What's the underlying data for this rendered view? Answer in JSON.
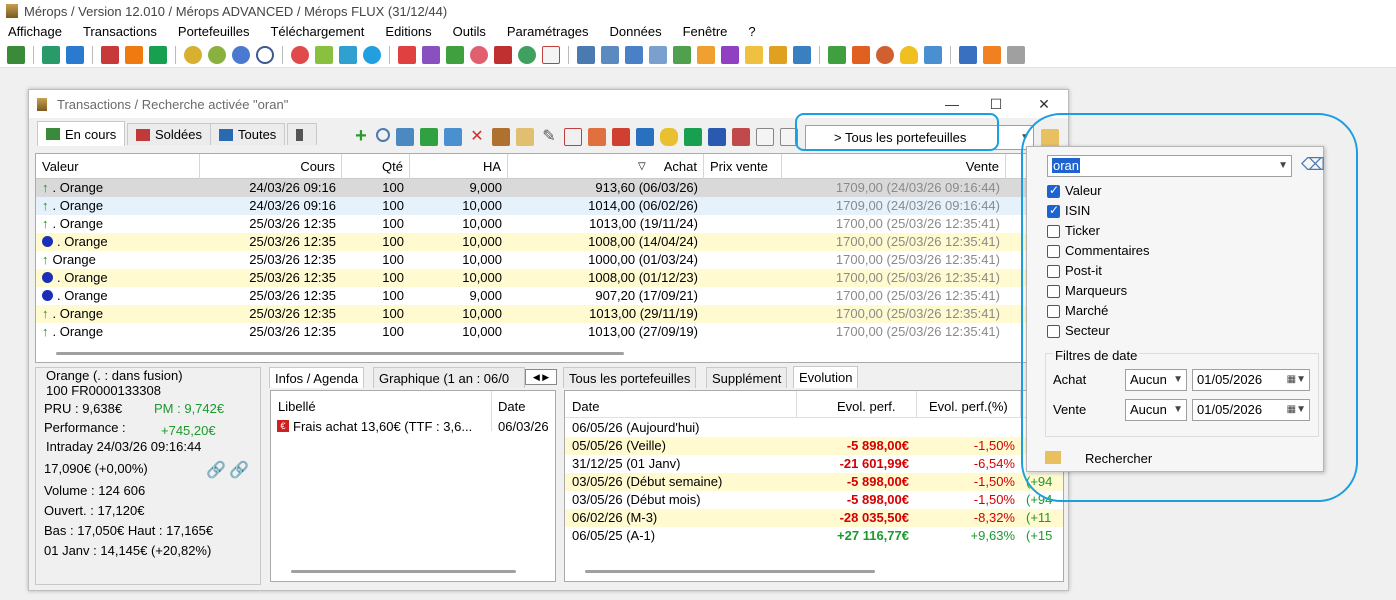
{
  "app": {
    "title": "Mérops / Version 12.010 / Mérops ADVANCED / Mérops FLUX (31/12/44)"
  },
  "menu": [
    "Affichage",
    "Transactions",
    "Portefeuilles",
    "Téléchargement",
    "Editions",
    "Outils",
    "Paramétrages",
    "Données",
    "Fenêtre",
    "?"
  ],
  "window": {
    "title": "Transactions / Recherche activée \"oran\"",
    "tabs": [
      "En cours",
      "Soldées",
      "Toutes"
    ],
    "portfolio_selector": "> Tous les portefeuilles"
  },
  "grid": {
    "columns": [
      "Valeur",
      "Cours",
      "Qté",
      "HA",
      "Achat",
      "Prix vente",
      "Vente"
    ],
    "rows": [
      {
        "mark": "arrow",
        "valeur": ". Orange",
        "cours": "24/03/26 09:16",
        "qte": "100",
        "ha": "9,000",
        "achat": "913,60 (06/03/26)",
        "vente": "1709,00 (24/03/26 09:16:44)"
      },
      {
        "mark": "arrow",
        "valeur": ". Orange",
        "cours": "24/03/26 09:16",
        "qte": "100",
        "ha": "10,000",
        "achat": "1014,00 (06/02/26)",
        "vente": "1709,00 (24/03/26 09:16:44)"
      },
      {
        "mark": "arrow",
        "valeur": ". Orange",
        "cours": "25/03/26 12:35",
        "qte": "100",
        "ha": "10,000",
        "achat": "1013,00 (19/11/24)",
        "vente": "1700,00 (25/03/26 12:35:41)"
      },
      {
        "mark": "dot",
        "valeur": ". Orange",
        "cours": "25/03/26 12:35",
        "qte": "100",
        "ha": "10,000",
        "achat": "1008,00 (14/04/24)",
        "vente": "1700,00 (25/03/26 12:35:41)"
      },
      {
        "mark": "arrow",
        "valeur": "Orange",
        "cours": "25/03/26 12:35",
        "qte": "100",
        "ha": "10,000",
        "achat": "1000,00 (01/03/24)",
        "vente": "1700,00 (25/03/26 12:35:41)"
      },
      {
        "mark": "dot",
        "valeur": ". Orange",
        "cours": "25/03/26 12:35",
        "qte": "100",
        "ha": "10,000",
        "achat": "1008,00 (01/12/23)",
        "vente": "1700,00 (25/03/26 12:35:41)"
      },
      {
        "mark": "dot",
        "valeur": ". Orange",
        "cours": "25/03/26 12:35",
        "qte": "100",
        "ha": "9,000",
        "achat": "907,20 (17/09/21)",
        "vente": "1700,00 (25/03/26 12:35:41)"
      },
      {
        "mark": "arrow",
        "valeur": ". Orange",
        "cours": "25/03/26 12:35",
        "qte": "100",
        "ha": "10,000",
        "achat": "1013,00 (29/11/19)",
        "vente": "1700,00 (25/03/26 12:35:41)"
      },
      {
        "mark": "arrow",
        "valeur": ". Orange",
        "cours": "25/03/26 12:35",
        "qte": "100",
        "ha": "10,000",
        "achat": "1013,00 (27/09/19)",
        "vente": "1700,00 (25/03/26 12:35:41)"
      }
    ]
  },
  "info": {
    "name": "Orange (. : dans fusion)",
    "isin": "100 FR0000133308",
    "pru": "PRU : 9,638€",
    "pm": "PM : 9,742€",
    "performance_label": "Performance :",
    "performance_value": "+745,20€",
    "intraday": "Intraday 24/03/26 09:16:44",
    "price": "17,090€ (+0,00%)",
    "volume": "Volume : 124 606",
    "ouvert": "Ouvert. : 17,120€",
    "bas_haut": "Bas : 17,050€ Haut : 17,165€",
    "janv": "01 Janv : 14,145€ (+20,82%)"
  },
  "mid_tabs": [
    "Infos / Agenda",
    "Graphique (1 an : 06/0"
  ],
  "agenda": {
    "columns": [
      "Libellé",
      "Date"
    ],
    "rows": [
      {
        "libelle": "Frais achat 13,60€ (TTF : 3,6...",
        "date": "06/03/26"
      }
    ]
  },
  "right_tabs": [
    "Tous les portefeuilles",
    "Supplément",
    "Evolution"
  ],
  "evolution": {
    "columns": [
      "Date",
      "Evol. perf.",
      "Evol. perf.(%)"
    ],
    "rows": [
      {
        "date": "06/05/26 (Aujourd'hui)",
        "perf": "",
        "pct": "",
        "extra": "(+"
      },
      {
        "date": "05/05/26 (Veille)",
        "perf": "-5 898,00€",
        "pct": "-1,50%",
        "extra": "(+"
      },
      {
        "date": "31/12/25 (01 Janv)",
        "perf": "-21 601,99€",
        "pct": "-6,54%",
        "extra": "(+"
      },
      {
        "date": "03/05/26 (Début semaine)",
        "perf": "-5 898,00€",
        "pct": "-1,50%",
        "extra": "(+94"
      },
      {
        "date": "03/05/26 (Début mois)",
        "perf": "-5 898,00€",
        "pct": "-1,50%",
        "extra": "(+94"
      },
      {
        "date": "06/02/26 (M-3)",
        "perf": "-28 035,50€",
        "pct": "-8,32%",
        "extra": "(+11"
      },
      {
        "date": "06/05/25 (A-1)",
        "perf": "+27 116,77€",
        "pct": "+9,63%",
        "extra": "(+15"
      }
    ]
  },
  "search": {
    "query": "oran",
    "options": [
      {
        "label": "Valeur",
        "checked": true
      },
      {
        "label": "ISIN",
        "checked": true
      },
      {
        "label": "Ticker",
        "checked": false
      },
      {
        "label": "Commentaires",
        "checked": false
      },
      {
        "label": "Post-it",
        "checked": false
      },
      {
        "label": "Marqueurs",
        "checked": false
      },
      {
        "label": "Marché",
        "checked": false
      },
      {
        "label": "Secteur",
        "checked": false
      }
    ],
    "date_filters_label": "Filtres de date",
    "achat_label": "Achat",
    "vente_label": "Vente",
    "achat_mode": "Aucun",
    "vente_mode": "Aucun",
    "achat_date": "01/05/2026",
    "vente_date": "01/05/2026",
    "search_button": "Rechercher"
  },
  "colors": {
    "accent_highlight": "#1aa0e0",
    "row_yellow": "#fffad0",
    "row_gray": "#dcdcdc",
    "row_blue": "#e6f3ff"
  }
}
